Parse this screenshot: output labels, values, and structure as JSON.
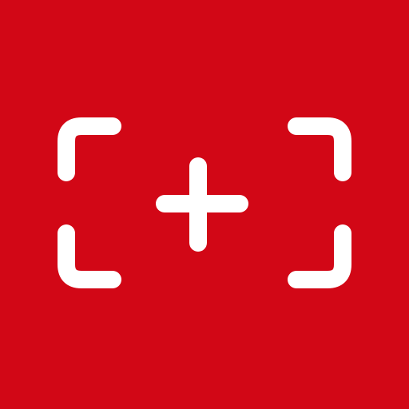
{
  "app_icon": {
    "name": "add-photo-frame-app-icon",
    "background_color": "#d20716",
    "glyph_color": "#ffffff",
    "icons": [
      "viewfinder-icon",
      "plus-icon"
    ]
  }
}
